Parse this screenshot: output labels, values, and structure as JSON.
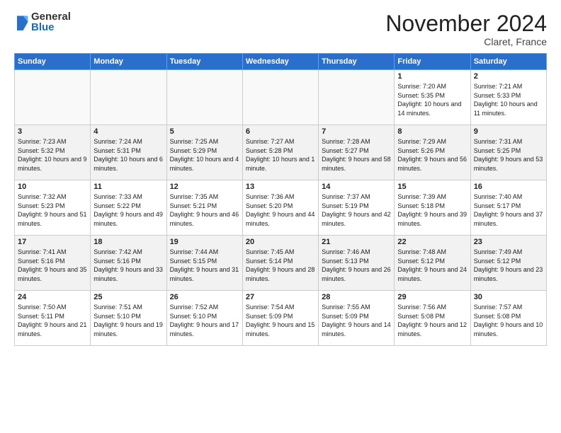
{
  "header": {
    "logo_general": "General",
    "logo_blue": "Blue",
    "month_title": "November 2024",
    "location": "Claret, France"
  },
  "days_of_week": [
    "Sunday",
    "Monday",
    "Tuesday",
    "Wednesday",
    "Thursday",
    "Friday",
    "Saturday"
  ],
  "weeks": [
    [
      {
        "day": "",
        "info": ""
      },
      {
        "day": "",
        "info": ""
      },
      {
        "day": "",
        "info": ""
      },
      {
        "day": "",
        "info": ""
      },
      {
        "day": "",
        "info": ""
      },
      {
        "day": "1",
        "info": "Sunrise: 7:20 AM\nSunset: 5:35 PM\nDaylight: 10 hours and 14 minutes."
      },
      {
        "day": "2",
        "info": "Sunrise: 7:21 AM\nSunset: 5:33 PM\nDaylight: 10 hours and 11 minutes."
      }
    ],
    [
      {
        "day": "3",
        "info": "Sunrise: 7:23 AM\nSunset: 5:32 PM\nDaylight: 10 hours and 9 minutes."
      },
      {
        "day": "4",
        "info": "Sunrise: 7:24 AM\nSunset: 5:31 PM\nDaylight: 10 hours and 6 minutes."
      },
      {
        "day": "5",
        "info": "Sunrise: 7:25 AM\nSunset: 5:29 PM\nDaylight: 10 hours and 4 minutes."
      },
      {
        "day": "6",
        "info": "Sunrise: 7:27 AM\nSunset: 5:28 PM\nDaylight: 10 hours and 1 minute."
      },
      {
        "day": "7",
        "info": "Sunrise: 7:28 AM\nSunset: 5:27 PM\nDaylight: 9 hours and 58 minutes."
      },
      {
        "day": "8",
        "info": "Sunrise: 7:29 AM\nSunset: 5:26 PM\nDaylight: 9 hours and 56 minutes."
      },
      {
        "day": "9",
        "info": "Sunrise: 7:31 AM\nSunset: 5:25 PM\nDaylight: 9 hours and 53 minutes."
      }
    ],
    [
      {
        "day": "10",
        "info": "Sunrise: 7:32 AM\nSunset: 5:23 PM\nDaylight: 9 hours and 51 minutes."
      },
      {
        "day": "11",
        "info": "Sunrise: 7:33 AM\nSunset: 5:22 PM\nDaylight: 9 hours and 49 minutes."
      },
      {
        "day": "12",
        "info": "Sunrise: 7:35 AM\nSunset: 5:21 PM\nDaylight: 9 hours and 46 minutes."
      },
      {
        "day": "13",
        "info": "Sunrise: 7:36 AM\nSunset: 5:20 PM\nDaylight: 9 hours and 44 minutes."
      },
      {
        "day": "14",
        "info": "Sunrise: 7:37 AM\nSunset: 5:19 PM\nDaylight: 9 hours and 42 minutes."
      },
      {
        "day": "15",
        "info": "Sunrise: 7:39 AM\nSunset: 5:18 PM\nDaylight: 9 hours and 39 minutes."
      },
      {
        "day": "16",
        "info": "Sunrise: 7:40 AM\nSunset: 5:17 PM\nDaylight: 9 hours and 37 minutes."
      }
    ],
    [
      {
        "day": "17",
        "info": "Sunrise: 7:41 AM\nSunset: 5:16 PM\nDaylight: 9 hours and 35 minutes."
      },
      {
        "day": "18",
        "info": "Sunrise: 7:42 AM\nSunset: 5:16 PM\nDaylight: 9 hours and 33 minutes."
      },
      {
        "day": "19",
        "info": "Sunrise: 7:44 AM\nSunset: 5:15 PM\nDaylight: 9 hours and 31 minutes."
      },
      {
        "day": "20",
        "info": "Sunrise: 7:45 AM\nSunset: 5:14 PM\nDaylight: 9 hours and 28 minutes."
      },
      {
        "day": "21",
        "info": "Sunrise: 7:46 AM\nSunset: 5:13 PM\nDaylight: 9 hours and 26 minutes."
      },
      {
        "day": "22",
        "info": "Sunrise: 7:48 AM\nSunset: 5:12 PM\nDaylight: 9 hours and 24 minutes."
      },
      {
        "day": "23",
        "info": "Sunrise: 7:49 AM\nSunset: 5:12 PM\nDaylight: 9 hours and 23 minutes."
      }
    ],
    [
      {
        "day": "24",
        "info": "Sunrise: 7:50 AM\nSunset: 5:11 PM\nDaylight: 9 hours and 21 minutes."
      },
      {
        "day": "25",
        "info": "Sunrise: 7:51 AM\nSunset: 5:10 PM\nDaylight: 9 hours and 19 minutes."
      },
      {
        "day": "26",
        "info": "Sunrise: 7:52 AM\nSunset: 5:10 PM\nDaylight: 9 hours and 17 minutes."
      },
      {
        "day": "27",
        "info": "Sunrise: 7:54 AM\nSunset: 5:09 PM\nDaylight: 9 hours and 15 minutes."
      },
      {
        "day": "28",
        "info": "Sunrise: 7:55 AM\nSunset: 5:09 PM\nDaylight: 9 hours and 14 minutes."
      },
      {
        "day": "29",
        "info": "Sunrise: 7:56 AM\nSunset: 5:08 PM\nDaylight: 9 hours and 12 minutes."
      },
      {
        "day": "30",
        "info": "Sunrise: 7:57 AM\nSunset: 5:08 PM\nDaylight: 9 hours and 10 minutes."
      }
    ]
  ]
}
